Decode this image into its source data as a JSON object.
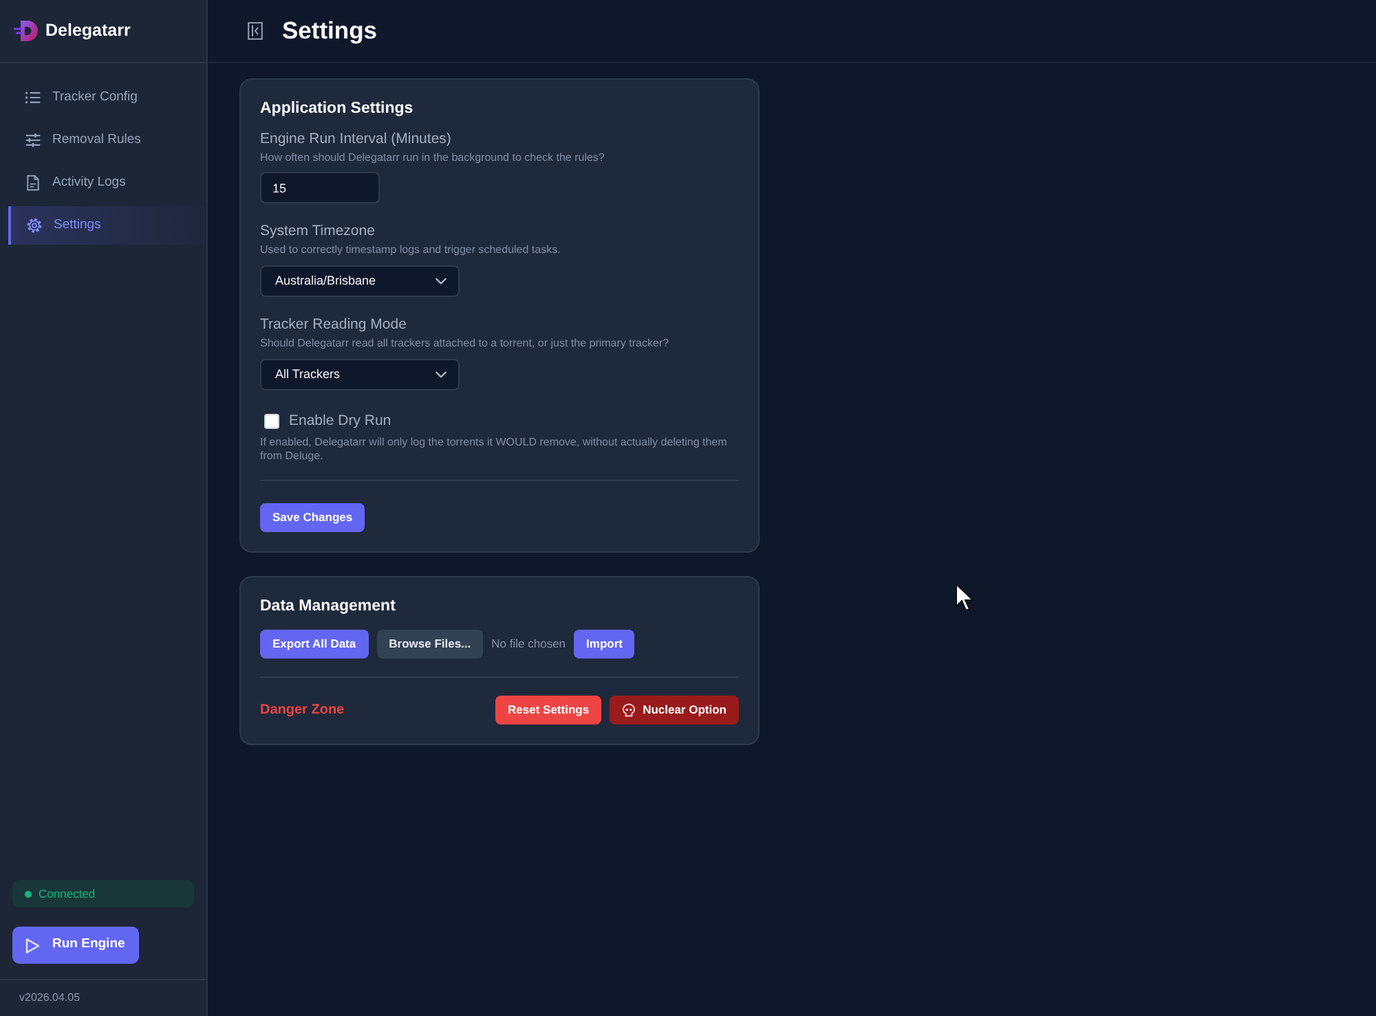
{
  "sidebar": {
    "brand": "Delegatarr",
    "items": [
      {
        "label": "Tracker Config",
        "selected": false
      },
      {
        "label": "Removal Rules",
        "selected": false
      },
      {
        "label": "Activity Logs",
        "selected": false
      },
      {
        "label": "Settings",
        "selected": true
      }
    ],
    "status": "Connected",
    "run_button": "Run Engine",
    "version": "v2026.04.05"
  },
  "header": {
    "title": "Settings"
  },
  "application_settings": {
    "title": "Application Settings",
    "fields": [
      {
        "kind": "number",
        "label": "Engine Run Interval (Minutes)",
        "hint": "How often should Delegatarr run in the background to check the rules?",
        "value": "15"
      },
      {
        "kind": "select",
        "label": "System Timezone",
        "hint": "Used to correctly timestamp logs and trigger scheduled tasks.",
        "value": "Australia/Brisbane"
      },
      {
        "kind": "select",
        "label": "Tracker Reading Mode",
        "hint": "Should Delegatarr read all trackers attached to a torrent, or just the primary tracker?",
        "value": "All Trackers"
      },
      {
        "kind": "checkbox",
        "label": "Enable Dry Run",
        "checked": false,
        "hint": "If enabled, Delegatarr will only log the torrents it WOULD remove, without actually deleting them from Deluge."
      }
    ],
    "save_button": "Save Changes"
  },
  "data_management": {
    "title": "Data Management",
    "export_button": "Export All Data",
    "browse_button": "Browse Files...",
    "file_status": "No file chosen",
    "import_button": "Import",
    "danger_zone": {
      "title": "Danger Zone",
      "reset_button": "Reset Settings",
      "nuclear_button": "Nuclear Option"
    }
  }
}
